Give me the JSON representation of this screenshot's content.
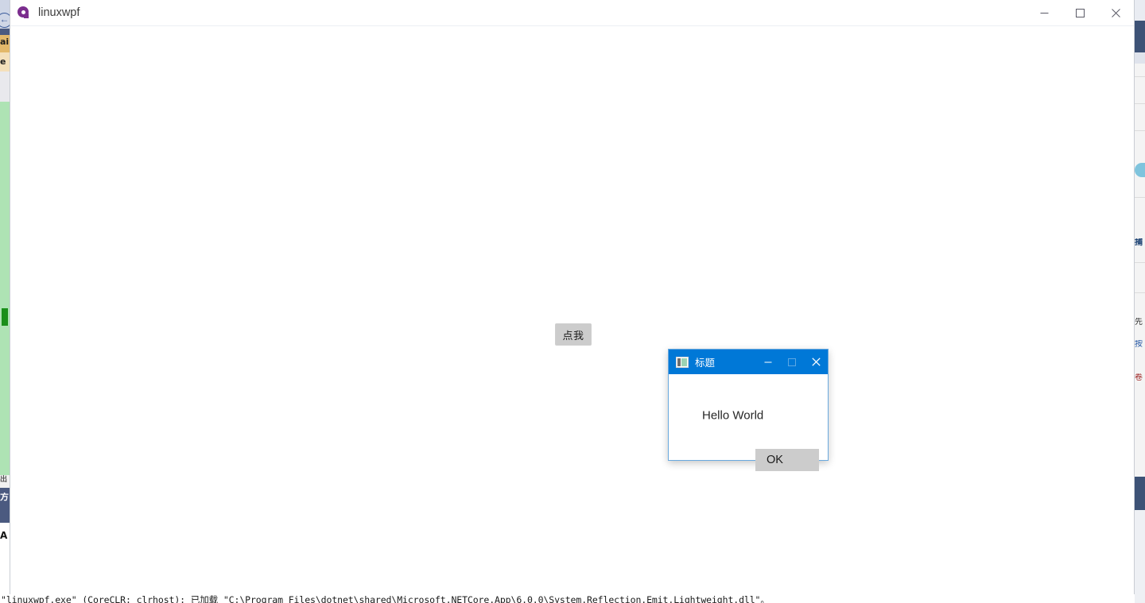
{
  "background": {
    "left_sliver_label": "partially-occluded-ide-window",
    "back_icon": "←",
    "glyphs_left": [
      "ai",
      "e",
      "出",
      "方",
      "A"
    ],
    "glyphs_right": [
      "捕",
      "先",
      "按",
      "卷"
    ],
    "console_text": "\"linuxwpf.exe\" (CoreCLR: clrhost): 已加载 \"C:\\Program Files\\dotnet\\shared\\Microsoft.NETCore.App\\6.0.0\\System.Reflection.Emit.Lightweight.dll\"。"
  },
  "main_window": {
    "title": "linuxwpf",
    "icon": "app-logo-icon",
    "controls": {
      "minimize": "—",
      "maximize": "□",
      "close": "✕"
    },
    "click_me_button": "点我"
  },
  "dialog": {
    "title": "标题",
    "icon": "dialog-window-icon",
    "message": "Hello World",
    "ok_label": "OK",
    "controls": {
      "minimize": "—",
      "maximize": "□",
      "close": "✕"
    },
    "accent_color": "#0078d7",
    "button_color": "#cccccc"
  }
}
